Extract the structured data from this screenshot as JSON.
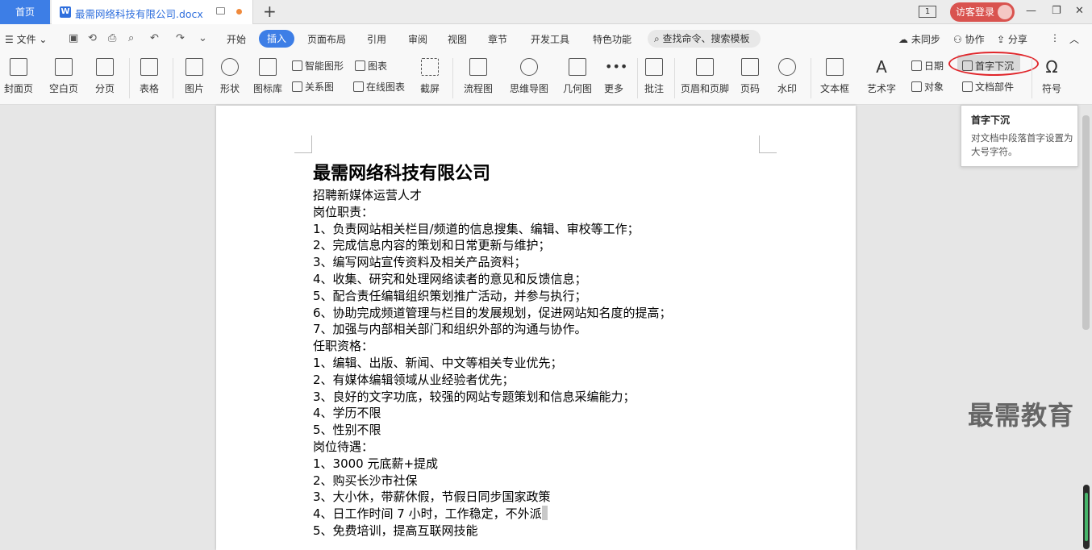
{
  "tabbar": {
    "home": "首页",
    "doc_icon": "W",
    "doc_title": "最需网络科技有限公司.docx",
    "page_indicator": "1",
    "login": "访客登录"
  },
  "menu": {
    "file": "文件",
    "items": [
      "开始",
      "插入",
      "页面布局",
      "引用",
      "审阅",
      "视图",
      "章节",
      "开发工具",
      "特色功能"
    ],
    "search": "查找命令、搜索模板",
    "sync": "未同步",
    "collab": "协作",
    "share": "分享"
  },
  "ribbon": {
    "cover": "封面页",
    "blank": "空白页",
    "pagebreak": "分页",
    "table": "表格",
    "picture": "图片",
    "shape": "形状",
    "iconlib": "图标库",
    "smartshape": "智能图形",
    "chart": "图表",
    "relation": "关系图",
    "onlinechart": "在线图表",
    "screenshot": "截屏",
    "flowchart": "流程图",
    "mindmap": "思维导图",
    "geometry": "几何图",
    "more": "更多",
    "comment": "批注",
    "headerfooter": "页眉和页脚",
    "pagenum": "页码",
    "watermark": "水印",
    "textbox": "文本框",
    "wordart": "艺术字",
    "date": "日期",
    "dropcap": "首字下沉",
    "object": "对象",
    "docpart": "文档部件",
    "symbol": "符号"
  },
  "tooltip": {
    "title": "首字下沉",
    "desc": "对文档中段落首字设置为大号字符。"
  },
  "document": {
    "heading": "最需网络科技有限公司",
    "lines": [
      "招聘新媒体运营人才",
      "岗位职责：",
      "1、负责网站相关栏目/频道的信息搜集、编辑、审校等工作；",
      "2、完成信息内容的策划和日常更新与维护；",
      "3、编写网站宣传资料及相关产品资料；",
      "4、收集、研究和处理网络读者的意见和反馈信息；",
      "5、配合责任编辑组织策划推广活动，并参与执行；",
      "6、协助完成频道管理与栏目的发展规划，促进网站知名度的提高；",
      "7、加强与内部相关部门和组织外部的沟通与协作。",
      "任职资格：",
      "1、编辑、出版、新闻、中文等相关专业优先；",
      "2、有媒体编辑领域从业经验者优先；",
      "3、良好的文字功底，较强的网站专题策划和信息采编能力；",
      "4、学历不限",
      "5、性别不限",
      "岗位待遇：",
      "1、3000 元底薪+提成",
      "2、购买长沙市社保",
      "3、大小休，带薪休假，节假日同步国家政策",
      "4、日工作时间 7 小时，工作稳定，不外派",
      "5、免费培训，提高互联网技能"
    ]
  },
  "watermark_text": "最需教育"
}
